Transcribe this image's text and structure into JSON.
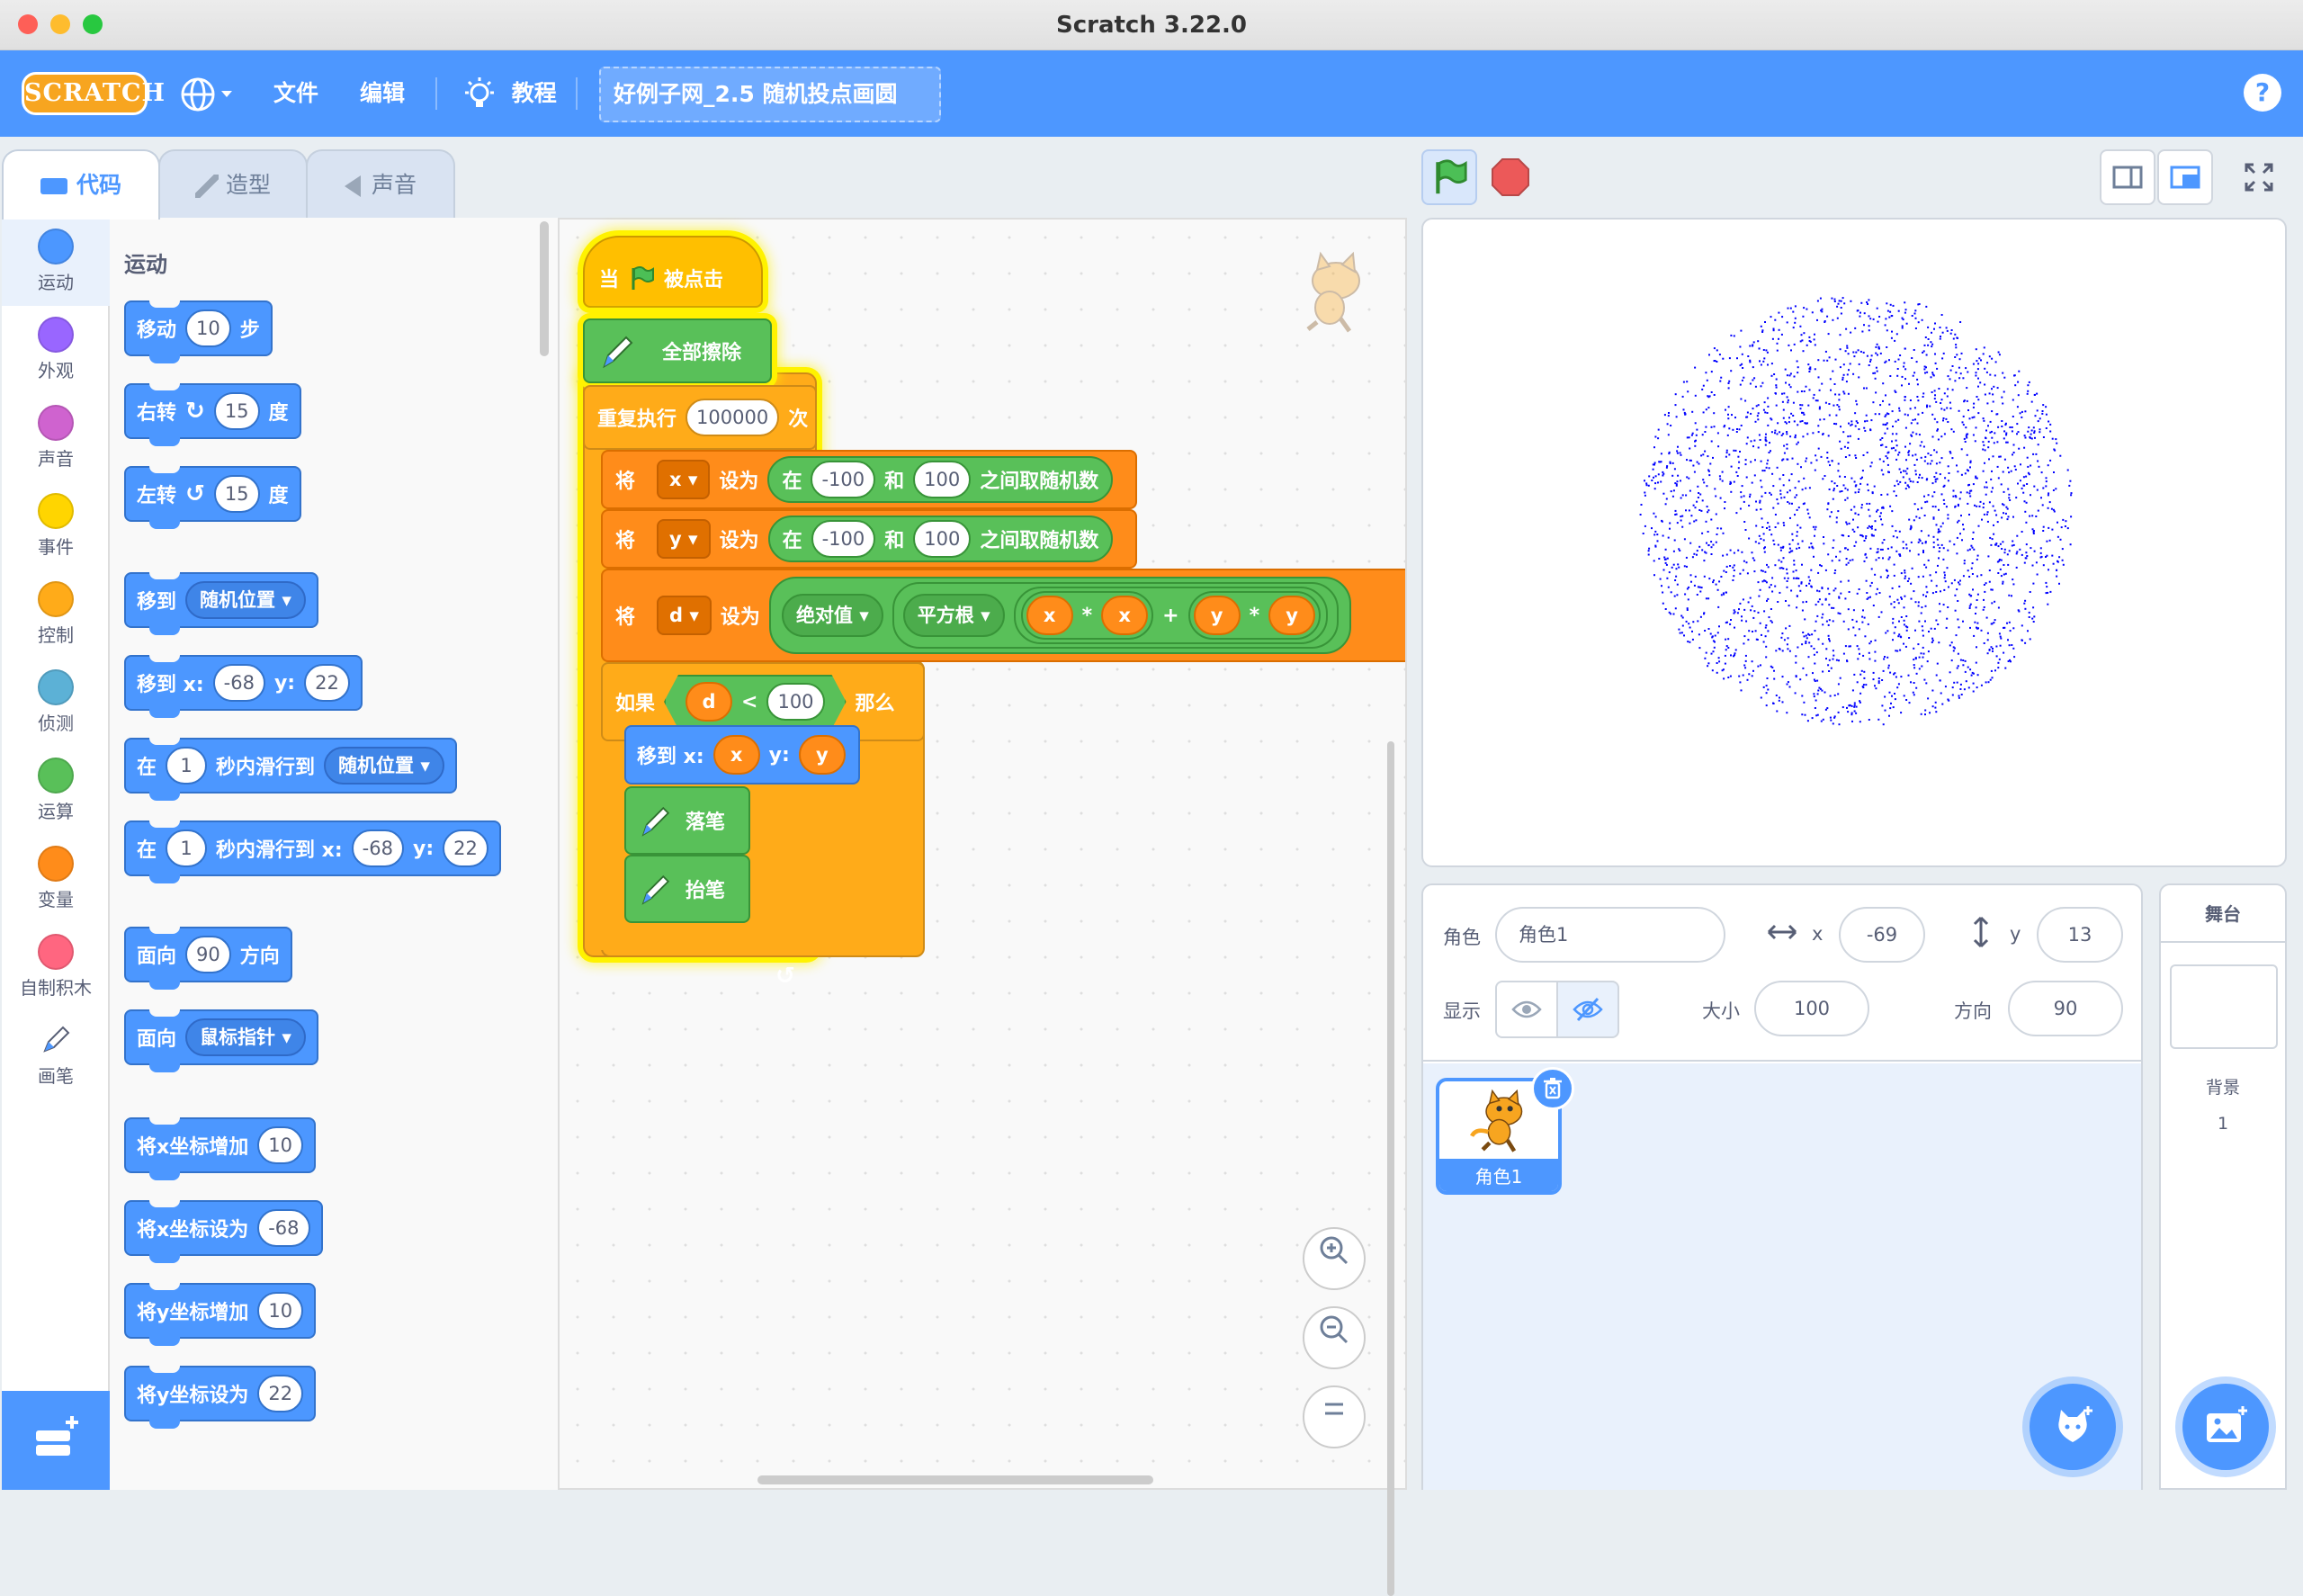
{
  "window": {
    "title": "Scratch 3.22.0"
  },
  "menubar": {
    "logo": "SCRATCH",
    "globe": "globe-icon",
    "file": "文件",
    "edit": "编辑",
    "tutorials": "教程",
    "project_title": "好例子网_2.5 随机投点画圆",
    "help": "?"
  },
  "tabs": {
    "code": "代码",
    "costumes": "造型",
    "sounds": "声音"
  },
  "categories": [
    {
      "label": "运动",
      "color": "#4c97ff"
    },
    {
      "label": "外观",
      "color": "#9966ff"
    },
    {
      "label": "声音",
      "color": "#cf63cf"
    },
    {
      "label": "事件",
      "color": "#ffd500"
    },
    {
      "label": "控制",
      "color": "#ffab19"
    },
    {
      "label": "侦测",
      "color": "#5cb1d6"
    },
    {
      "label": "运算",
      "color": "#59c059"
    },
    {
      "label": "变量",
      "color": "#ff8c1a"
    },
    {
      "label": "自制积木",
      "color": "#ff6680"
    },
    {
      "label": "画笔",
      "color": "#0fbd8c"
    }
  ],
  "palette": {
    "heading": "运动",
    "move": {
      "a": "移动",
      "n": "10",
      "b": "步"
    },
    "turn_right": {
      "a": "右转",
      "n": "15",
      "b": "度"
    },
    "turn_left": {
      "a": "左转",
      "n": "15",
      "b": "度"
    },
    "goto": {
      "a": "移到",
      "d": "随机位置"
    },
    "goto_xy": {
      "a": "移到 x:",
      "x": "-68",
      "b": "y:",
      "y": "22"
    },
    "glide": {
      "a": "在",
      "n": "1",
      "b": "秒内滑行到",
      "d": "随机位置"
    },
    "glide_xy": {
      "a": "在",
      "n": "1",
      "b": "秒内滑行到 x:",
      "x": "-68",
      "c": "y:",
      "y": "22"
    },
    "point_dir": {
      "a": "面向",
      "n": "90",
      "b": "方向"
    },
    "point_to": {
      "a": "面向",
      "d": "鼠标指针"
    },
    "change_x": {
      "a": "将x坐标增加",
      "n": "10"
    },
    "set_x": {
      "a": "将x坐标设为",
      "n": "-68"
    },
    "change_y": {
      "a": "将y坐标增加",
      "n": "10"
    },
    "set_y": {
      "a": "将y坐标设为",
      "n": "22"
    }
  },
  "script": {
    "hat": {
      "a": "当",
      "b": "被点击"
    },
    "clear": "全部擦除",
    "repeat": {
      "a": "重复执行",
      "n": "100000",
      "b": "次"
    },
    "set_x": {
      "a": "将",
      "var": "x",
      "b": "设为",
      "c": "在",
      "lo": "-100",
      "d": "和",
      "hi": "100",
      "e": "之间取随机数"
    },
    "set_y": {
      "a": "将",
      "var": "y",
      "b": "设为",
      "c": "在",
      "lo": "-100",
      "d": "和",
      "hi": "100",
      "e": "之间取随机数"
    },
    "set_d": {
      "a": "将",
      "var": "d",
      "b": "设为",
      "abs": "绝对值",
      "sqrt": "平方根",
      "x1": "x",
      "mul1": "*",
      "x2": "x",
      "plus": "+",
      "y1": "y",
      "mul2": "*",
      "y2": "y"
    },
    "if": {
      "a": "如果",
      "var": "d",
      "lt": "<",
      "n": "100",
      "b": "那么"
    },
    "goto": {
      "a": "移到 x:",
      "x": "x",
      "b": "y:",
      "y": "y"
    },
    "pen_down": "落笔",
    "pen_up": "抬笔"
  },
  "sprite_info": {
    "sprite_label": "角色",
    "sprite_name": "角色1",
    "x_label": "x",
    "x": "-69",
    "y_label": "y",
    "y": "13",
    "show_label": "显示",
    "size_label": "大小",
    "size": "100",
    "dir_label": "方向",
    "dir": "90"
  },
  "sprite_list": [
    {
      "name": "角色1"
    }
  ],
  "stage_panel": {
    "title": "舞台",
    "backdrops_label": "背景",
    "backdrops_count": "1"
  },
  "stage": {
    "dot_color": "#0000ff",
    "circle_radius_units": 100
  }
}
